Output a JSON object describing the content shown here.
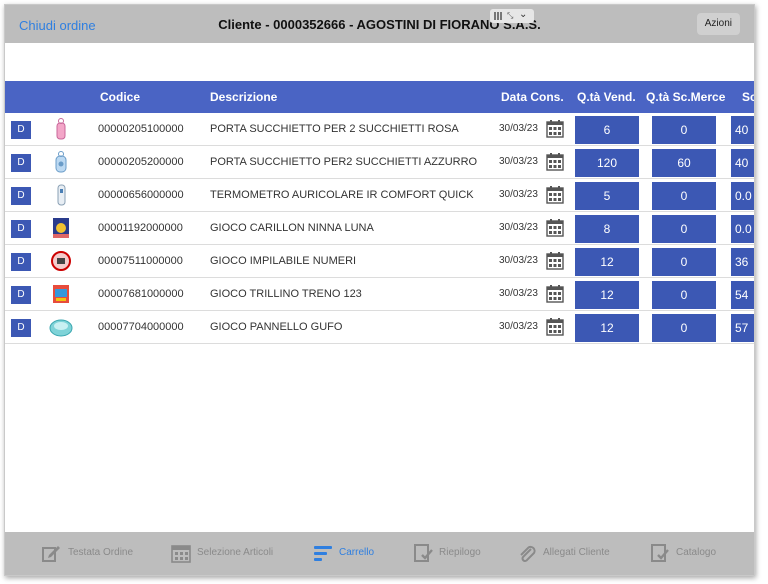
{
  "topbar": {
    "close_label": "Chiudi ordine",
    "title": "Cliente - 0000352666 - AGOSTINI DI FIORANO S.A.S.",
    "actions_label": "Azioni"
  },
  "table": {
    "headers": {
      "codice": "Codice",
      "descrizione": "Descrizione",
      "data_cons": "Data Cons.",
      "qta_vend": "Q.tà Vend.",
      "qta_sc": "Q.tà Sc.Merce",
      "sc": "Sc"
    },
    "rows": [
      {
        "d": "D",
        "thumb": "pacifier-case-pink",
        "code": "00000205100000",
        "desc": "PORTA SUCCHIETTO PER 2 SUCCHIETTI ROSA",
        "date": "30/03/23",
        "qv": "6",
        "qs": "0",
        "sc": "40"
      },
      {
        "d": "D",
        "thumb": "pacifier-case-blue",
        "code": "00000205200000",
        "desc": "PORTA SUCCHIETTO PER2 SUCCHIETTI AZZURRO",
        "date": "30/03/23",
        "qv": "120",
        "qs": "60",
        "sc": "40"
      },
      {
        "d": "D",
        "thumb": "thermometer",
        "code": "00000656000000",
        "desc": "TERMOMETRO AURICOLARE IR COMFORT QUICK",
        "date": "30/03/23",
        "qv": "5",
        "qs": "0",
        "sc": "0.0"
      },
      {
        "d": "D",
        "thumb": "toy-box",
        "code": "00001192000000",
        "desc": "GIOCO CARILLON NINNA LUNA",
        "date": "30/03/23",
        "qv": "8",
        "qs": "0",
        "sc": "0.0"
      },
      {
        "d": "D",
        "thumb": "stacking-toy",
        "code": "00007511000000",
        "desc": "GIOCO IMPILABILE NUMERI",
        "date": "30/03/23",
        "qv": "12",
        "qs": "0",
        "sc": "36"
      },
      {
        "d": "D",
        "thumb": "train-toy-box",
        "code": "00007681000000",
        "desc": "GIOCO TRILLINO TRENO 123",
        "date": "30/03/23",
        "qv": "12",
        "qs": "0",
        "sc": "54"
      },
      {
        "d": "D",
        "thumb": "play-mat",
        "code": "00007704000000",
        "desc": "GIOCO PANNELLO GUFO",
        "date": "30/03/23",
        "qv": "12",
        "qs": "0",
        "sc": "57"
      }
    ]
  },
  "tabs": [
    {
      "label": "Testata Ordine",
      "icon": "edit-document-icon",
      "active": false
    },
    {
      "label": "Selezione Articoli",
      "icon": "calendar-grid-icon",
      "active": false
    },
    {
      "label": "Carrello",
      "icon": "cart-bars-icon",
      "active": true
    },
    {
      "label": "Riepilogo",
      "icon": "checklist-icon",
      "active": false
    },
    {
      "label": "Allegati Cliente",
      "icon": "paperclip-icon",
      "active": false
    },
    {
      "label": "Catalogo",
      "icon": "catalog-check-icon",
      "active": false
    }
  ],
  "colors": {
    "accent": "#2f7fe0",
    "header_blue": "#4a64c4",
    "cell_blue": "#3c58b4",
    "bar_grey": "#bdbdbd",
    "tab_inactive": "#8a8a8a"
  }
}
